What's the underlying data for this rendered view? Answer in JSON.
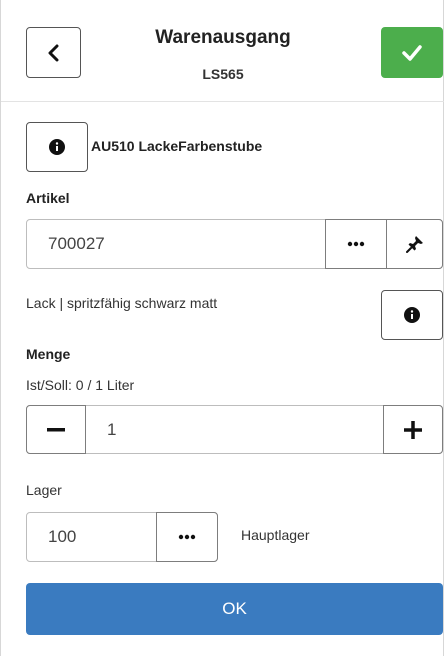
{
  "header": {
    "title": "Warenausgang",
    "subtitle": "LS565",
    "back_icon": "chevron-left-icon",
    "confirm_icon": "check-icon",
    "confirm_color": "#4cae4c"
  },
  "order": {
    "info_icon": "info-icon",
    "text": "AU510 LackeFarbenstube"
  },
  "artikel": {
    "label": "Artikel",
    "value": "700027",
    "more_icon": "ellipsis-icon",
    "pin_icon": "pin-icon",
    "description": "Lack | spritzfähig schwarz matt",
    "info_icon": "info-icon"
  },
  "menge": {
    "label": "Menge",
    "ist_soll": "Ist/Soll: 0 / 1 Liter",
    "value": "1",
    "minus_icon": "minus-icon",
    "plus_icon": "plus-icon"
  },
  "lager": {
    "label": "Lager",
    "value": "100",
    "more_icon": "ellipsis-icon",
    "name": "Hauptlager"
  },
  "ok_button": {
    "label": "OK",
    "color": "#3a7bc0"
  }
}
